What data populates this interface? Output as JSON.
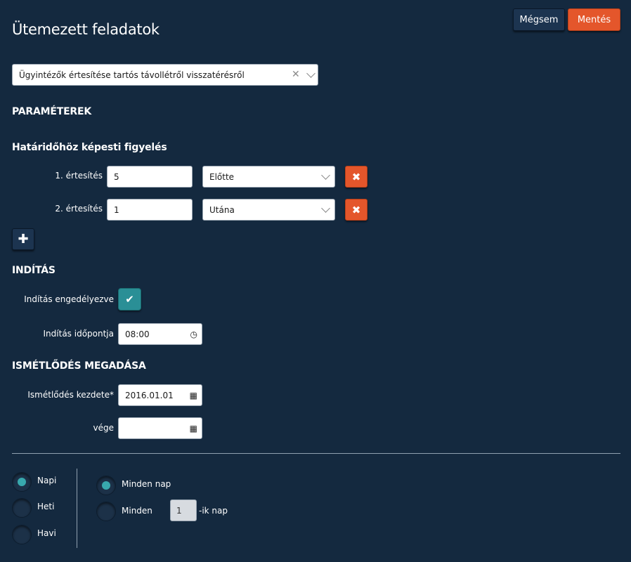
{
  "page": {
    "title": "Ütemezett feladatok"
  },
  "header": {
    "cancel_label": "Mégsem",
    "save_label": "Mentés"
  },
  "task_select": {
    "value": "Ügyintézők értesítése tartós távollétről visszatérésről",
    "clear_icon": "close-icon",
    "dropdown_icon": "chevron-down-icon"
  },
  "params": {
    "heading": "PARAMÉTEREK",
    "subheading": "Határidőhöz képesti figyelés",
    "notifications": [
      {
        "label": "1. értesítés",
        "value": "5",
        "mode": "Előtte"
      },
      {
        "label": "2. értesítés",
        "value": "1",
        "mode": "Utána"
      }
    ],
    "remove_icon": "close-icon",
    "add_icon": "plus-icon"
  },
  "start": {
    "heading": "INDÍTÁS",
    "enabled_label": "Indítás engedélyezve",
    "enabled": true,
    "time_label": "Indítás időpontja",
    "time_value": "08:00"
  },
  "repeat": {
    "heading": "ISMÉTLŐDÉS MEGADÁSA",
    "start_label": "Ismétlődés kezdete*",
    "start_value": "2016.01.01",
    "end_label": "vége",
    "end_value": ""
  },
  "frequency": {
    "options": [
      {
        "label": "Napi",
        "selected": true
      },
      {
        "label": "Heti",
        "selected": false
      },
      {
        "label": "Havi",
        "selected": false
      }
    ],
    "daily": {
      "every_day_label": "Minden nap",
      "every_day_selected": true,
      "every_label": "Minden",
      "every_value": "1",
      "every_suffix": "-ik nap"
    }
  },
  "colors": {
    "background": "#14293f",
    "accent": "#e4562b",
    "teal": "#38a8ad"
  }
}
